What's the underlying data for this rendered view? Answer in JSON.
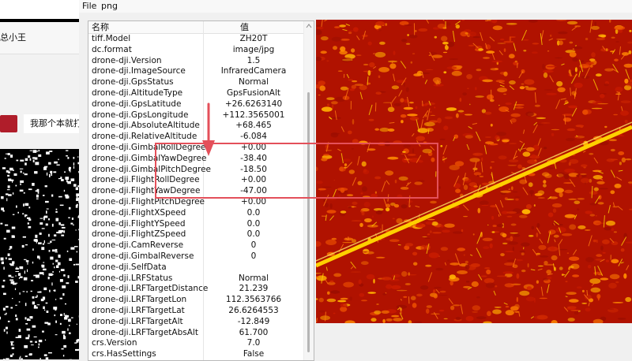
{
  "background_window": {
    "chat_title": "总小王",
    "message": "我那个本就打"
  },
  "menubar": {
    "file": "File",
    "png": "png"
  },
  "table": {
    "header_name": "名称",
    "header_value": "值",
    "rows": [
      {
        "name": "tiff.Model",
        "value": "ZH20T"
      },
      {
        "name": "dc.format",
        "value": "image/jpg"
      },
      {
        "name": "drone-dji.Version",
        "value": "1.5"
      },
      {
        "name": "drone-dji.ImageSource",
        "value": "InfraredCamera"
      },
      {
        "name": "drone-dji.GpsStatus",
        "value": "Normal"
      },
      {
        "name": "drone-dji.AltitudeType",
        "value": "GpsFusionAlt"
      },
      {
        "name": "drone-dji.GpsLatitude",
        "value": "+26.6263140"
      },
      {
        "name": "drone-dji.GpsLongitude",
        "value": "+112.3565001"
      },
      {
        "name": "drone-dji.AbsoluteAltitude",
        "value": "+68.465"
      },
      {
        "name": "drone-dji.RelativeAltitude",
        "value": "-6.084"
      },
      {
        "name": "drone-dji.GimbalRollDegree",
        "value": "+0.00"
      },
      {
        "name": "drone-dji.GimbalYawDegree",
        "value": "-38.40"
      },
      {
        "name": "drone-dji.GimbalPitchDegree",
        "value": "-18.50"
      },
      {
        "name": "drone-dji.FlightRollDegree",
        "value": "+0.00"
      },
      {
        "name": "drone-dji.FlightYawDegree",
        "value": "-47.00"
      },
      {
        "name": "drone-dji.FlightPitchDegree",
        "value": "+0.00"
      },
      {
        "name": "drone-dji.FlightXSpeed",
        "value": "0.0"
      },
      {
        "name": "drone-dji.FlightYSpeed",
        "value": "0.0"
      },
      {
        "name": "drone-dji.FlightZSpeed",
        "value": "0.0"
      },
      {
        "name": "drone-dji.CamReverse",
        "value": "0"
      },
      {
        "name": "drone-dji.GimbalReverse",
        "value": "0"
      },
      {
        "name": "drone-dji.SelfData",
        "value": ""
      },
      {
        "name": "drone-dji.LRFStatus",
        "value": "Normal"
      },
      {
        "name": "drone-dji.LRFTargetDistance",
        "value": "21.239"
      },
      {
        "name": "drone-dji.LRFTargetLon",
        "value": "112.3563766"
      },
      {
        "name": "drone-dji.LRFTargetLat",
        "value": "26.6264553"
      },
      {
        "name": "drone-dji.LRFTargetAlt",
        "value": "-12.849"
      },
      {
        "name": "drone-dji.LRFTargetAbsAlt",
        "value": "61.700"
      },
      {
        "name": "crs.Version",
        "value": "7.0"
      },
      {
        "name": "crs.HasSettings",
        "value": "False"
      }
    ]
  },
  "colors": {
    "highlight": "#e4505a",
    "thermal_dark": "#b01200",
    "thermal_hot": "#ffd000"
  }
}
